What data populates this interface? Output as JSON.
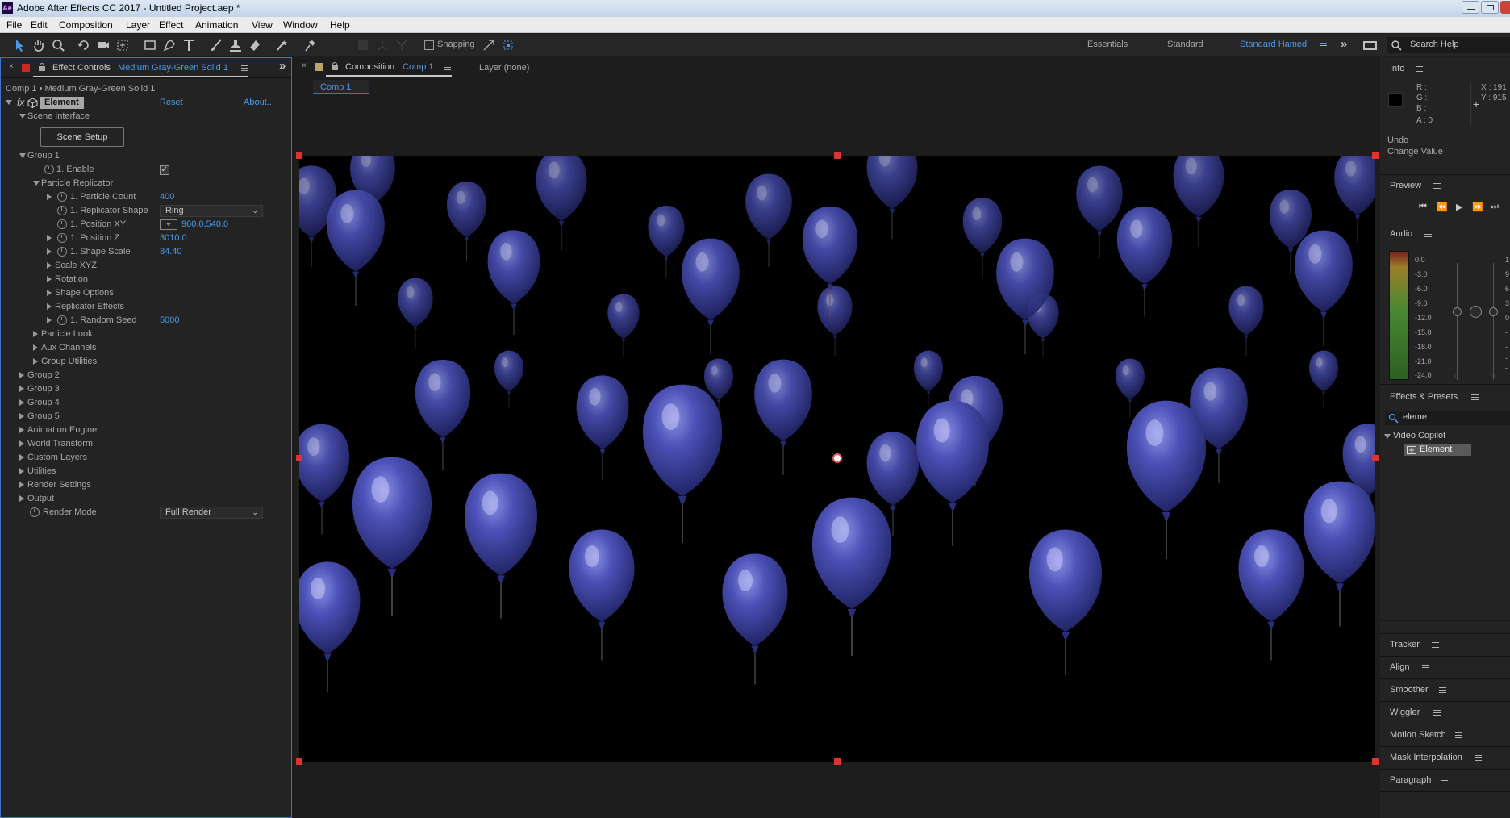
{
  "window": {
    "title": "Adobe After Effects CC 2017 - Untitled Project.aep *",
    "app_icon": "Ae"
  },
  "menu": [
    "File",
    "Edit",
    "Composition",
    "Layer",
    "Effect",
    "Animation",
    "View",
    "Window",
    "Help"
  ],
  "toolbar": {
    "snapping_label": "Snapping",
    "workspaces": [
      "Essentials",
      "Standard",
      "Standard Hamed"
    ],
    "search_placeholder": "Search Help"
  },
  "effect_controls": {
    "tab_prefix": "Effect Controls",
    "tab_layer": "Medium Gray-Green Solid 1",
    "breadcrumb": "Comp 1 • Medium Gray-Green Solid 1",
    "effect_name": "Element",
    "fx_label": "fx",
    "reset": "Reset",
    "about": "About...",
    "scene_interface": "Scene Interface",
    "scene_setup": "Scene Setup",
    "group1": "Group 1",
    "enable": "1. Enable",
    "particle_replicator": "Particle Replicator",
    "particle_count": {
      "label": "1. Particle Count",
      "value": "400"
    },
    "replicator_shape": {
      "label": "1. Replicator Shape",
      "value": "Ring"
    },
    "position_xy": {
      "label": "1. Position XY",
      "value": "960.0,540.0"
    },
    "position_z": {
      "label": "1. Position Z",
      "value": "3010.0"
    },
    "shape_scale": {
      "label": "1. Shape Scale",
      "value": "84.40"
    },
    "scale_xyz": "Scale XYZ",
    "rotation": "Rotation",
    "shape_options": "Shape Options",
    "replicator_effects": "Replicator Effects",
    "random_seed": {
      "label": "1. Random Seed",
      "value": "5000"
    },
    "particle_look": "Particle Look",
    "aux_channels": "Aux Channels",
    "group_utilities": "Group Utilities",
    "groups": [
      "Group 2",
      "Group 3",
      "Group 4",
      "Group 5"
    ],
    "animation_engine": "Animation Engine",
    "world_transform": "World Transform",
    "custom_layers": "Custom Layers",
    "utilities": "Utilities",
    "render_settings": "Render Settings",
    "output": "Output",
    "render_mode": {
      "label": "Render Mode",
      "value": "Full Render"
    }
  },
  "composition": {
    "tab_prefix": "Composition",
    "tab_name": "Comp 1",
    "layer_tab": "Layer (none)",
    "subtab": "Comp 1"
  },
  "info": {
    "title": "Info",
    "r": "R :",
    "g": "G :",
    "b": "B :",
    "a": "A : 0",
    "x": "X : 191",
    "y": "Y : 915",
    "undo": "Undo",
    "change_value": "Change Value"
  },
  "preview": {
    "title": "Preview"
  },
  "audio": {
    "title": "Audio",
    "levels": [
      "0.0",
      "-3.0",
      "-6.0",
      "-9.0",
      "-12.0",
      "-15.0",
      "-18.0",
      "-21.0",
      "-24.0"
    ],
    "fader_zeros": [
      "0",
      "0"
    ],
    "right_edge_digits": [
      "1",
      "9",
      "6",
      "3",
      "0",
      "-",
      "-",
      "-",
      "-",
      "-"
    ]
  },
  "effects_presets": {
    "title": "Effects & Presets",
    "search_value": "eleme",
    "category": "Video Copilot",
    "item": "Element"
  },
  "panels": [
    "Tracker",
    "Align",
    "Smoother",
    "Wiggler",
    "Motion Sketch",
    "Mask Interpolation",
    "Paragraph"
  ],
  "colors": {
    "accent": "#3d74c6",
    "value_blue": "#4a9ae8",
    "balloon": "#3a3f9e"
  }
}
